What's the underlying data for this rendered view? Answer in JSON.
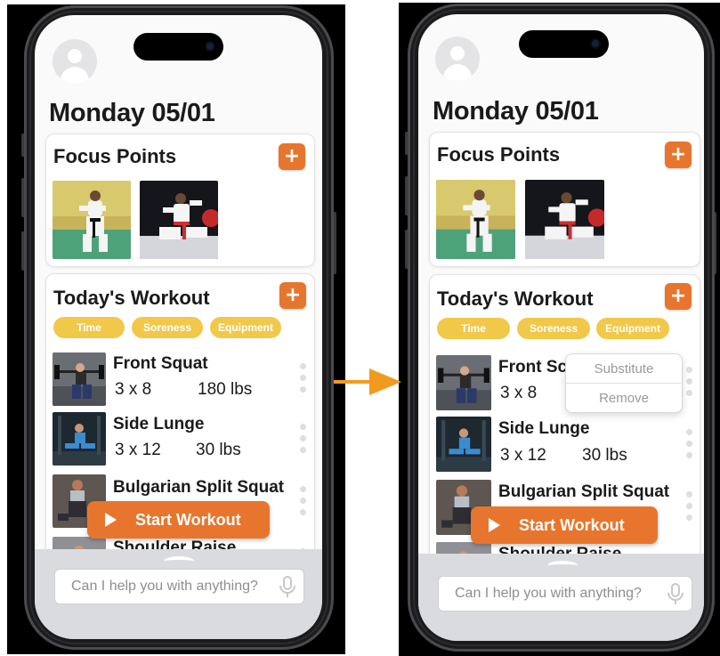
{
  "left_screen": {
    "date": "Monday 05/01",
    "focus": {
      "title": "Focus Points",
      "add": "+"
    },
    "workout": {
      "title": "Today's Workout",
      "add": "+",
      "chips": [
        "Time",
        "Soreness",
        "Equipment"
      ],
      "exercises": [
        {
          "name": "Front Squat",
          "sets": "3 x 8",
          "weight": "180 lbs"
        },
        {
          "name": "Side Lunge",
          "sets": "3 x 12",
          "weight": "30 lbs"
        },
        {
          "name": "Bulgarian Split Squat",
          "sets": "",
          "weight": ""
        },
        {
          "name": "Shoulder Raise",
          "sets": "",
          "weight": ""
        }
      ]
    },
    "start_label": "Start Workout",
    "assistant_placeholder": "Can I help you with anything?"
  },
  "right_screen": {
    "date": "Monday 05/01",
    "focus": {
      "title": "Focus Points",
      "add": "+"
    },
    "workout": {
      "title": "Today's Workout",
      "add": "+",
      "chips": [
        "Time",
        "Soreness",
        "Equipment"
      ],
      "exercises": [
        {
          "name": "Front Sc",
          "sets": "3 x 8",
          "weight": ""
        },
        {
          "name": "Side Lunge",
          "sets": "3 x 12",
          "weight": "30 lbs"
        },
        {
          "name": "Bulgarian Split Squat",
          "sets": "",
          "weight": ""
        },
        {
          "name": "Shoulder Raise",
          "sets": "",
          "weight": ""
        }
      ]
    },
    "context_menu": {
      "substitute": "Substitute",
      "remove": "Remove"
    },
    "start_label": "Start Workout",
    "assistant_placeholder": "Can I help you with anything?"
  },
  "colors": {
    "accent": "#e8752d",
    "chip": "#f2c84a",
    "arrow": "#f29a1f"
  }
}
